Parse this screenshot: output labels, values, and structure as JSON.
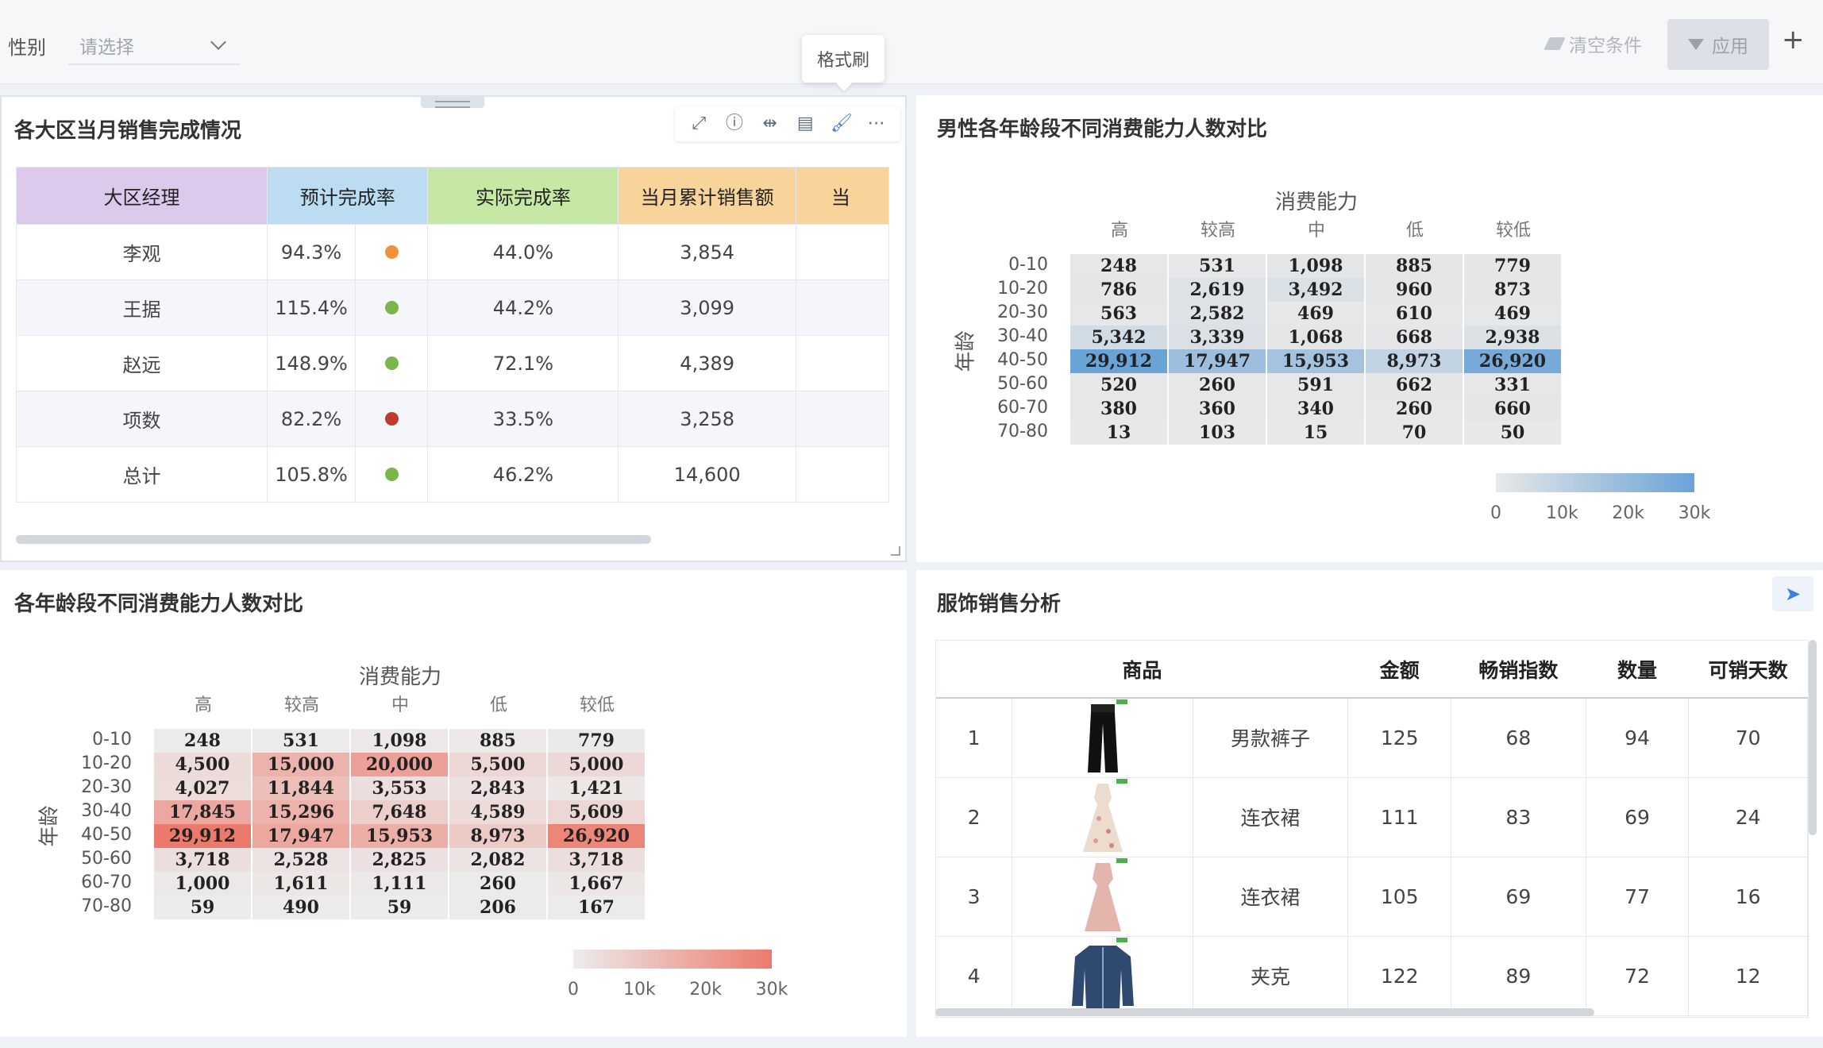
{
  "filter": {
    "label": "性别",
    "placeholder": "请选择",
    "clear_label": "清空条件",
    "apply_label": "应用",
    "add_symbol": "+"
  },
  "tooltip": "格式刷",
  "panel1": {
    "title": "各大区当月销售完成情况",
    "columns": [
      "大区经理",
      "预计完成率",
      "实际完成率",
      "当月累计销售额",
      "当"
    ],
    "header_colors": [
      "#dcc9ec",
      "#bcdcf2",
      "#c7e7a4",
      "#f8d49a",
      "#f8d49a"
    ],
    "rows": [
      {
        "name": "李观",
        "expected": "94.3%",
        "status_color": "#f0913a",
        "actual": "44.0%",
        "sales": "3,854"
      },
      {
        "name": "王据",
        "expected": "115.4%",
        "status_color": "#7ab648",
        "actual": "44.2%",
        "sales": "3,099"
      },
      {
        "name": "赵远",
        "expected": "148.9%",
        "status_color": "#7ab648",
        "actual": "72.1%",
        "sales": "4,389"
      },
      {
        "name": "项数",
        "expected": "82.2%",
        "status_color": "#c0392b",
        "actual": "33.5%",
        "sales": "3,258"
      },
      {
        "name": "总计",
        "expected": "105.8%",
        "status_color": "#7ab648",
        "actual": "46.2%",
        "sales": "14,600"
      }
    ]
  },
  "panel2": {
    "title": "男性各年龄段不同消费能力人数对比"
  },
  "panel3": {
    "title": "各年龄段不同消费能力人数对比"
  },
  "panel4": {
    "title": "服饰销售分析",
    "columns": [
      "商品",
      "金额",
      "畅销指数",
      "数量",
      "可销天数"
    ],
    "rows": [
      {
        "rank": "1",
        "name": "男款裤子",
        "amount": "125",
        "index": "68",
        "qty": "94",
        "days": "70",
        "img": "pants"
      },
      {
        "rank": "2",
        "name": "连衣裙",
        "amount": "111",
        "index": "83",
        "qty": "69",
        "days": "24",
        "img": "dress-floral"
      },
      {
        "rank": "3",
        "name": "连衣裙",
        "amount": "105",
        "index": "69",
        "qty": "77",
        "days": "16",
        "img": "dress-pink"
      },
      {
        "rank": "4",
        "name": "夹克",
        "amount": "122",
        "index": "89",
        "qty": "72",
        "days": "12",
        "img": "denim-jacket"
      }
    ]
  },
  "chart_data": [
    {
      "type": "heatmap",
      "title": "消费能力",
      "ylabel": "年龄",
      "columns": [
        "高",
        "较高",
        "中",
        "低",
        "较低"
      ],
      "rows": [
        "0-10",
        "10-20",
        "20-30",
        "30-40",
        "40-50",
        "50-60",
        "60-70",
        "70-80"
      ],
      "values": [
        [
          248,
          531,
          1098,
          885,
          779
        ],
        [
          786,
          2619,
          3492,
          960,
          873
        ],
        [
          563,
          2582,
          469,
          610,
          469
        ],
        [
          5342,
          3339,
          1068,
          668,
          2938
        ],
        [
          29912,
          17947,
          15953,
          8973,
          26920
        ],
        [
          520,
          260,
          591,
          662,
          331
        ],
        [
          380,
          360,
          340,
          260,
          660
        ],
        [
          13,
          103,
          15,
          70,
          50
        ]
      ],
      "labels": [
        [
          "248",
          "531",
          "1,098",
          "885",
          "779"
        ],
        [
          "786",
          "2,619",
          "3,492",
          "960",
          "873"
        ],
        [
          "563",
          "2,582",
          "469",
          "610",
          "469"
        ],
        [
          "5,342",
          "3,339",
          "1,068",
          "668",
          "2,938"
        ],
        [
          "29,912",
          "17,947",
          "15,953",
          "8,973",
          "26,920"
        ],
        [
          "520",
          "260",
          "591",
          "662",
          "331"
        ],
        [
          "380",
          "360",
          "340",
          "260",
          "660"
        ],
        [
          "13",
          "103",
          "15",
          "70",
          "50"
        ]
      ],
      "color_scale": {
        "min": 0,
        "max": 30000,
        "low_color": "#e8e8e8",
        "high_color": "#6aa3d6"
      },
      "legend_ticks": [
        "0",
        "10k",
        "20k",
        "30k"
      ]
    },
    {
      "type": "heatmap",
      "title": "消费能力",
      "ylabel": "年龄",
      "columns": [
        "高",
        "较高",
        "中",
        "低",
        "较低"
      ],
      "rows": [
        "0-10",
        "10-20",
        "20-30",
        "30-40",
        "40-50",
        "50-60",
        "60-70",
        "70-80"
      ],
      "values": [
        [
          248,
          531,
          1098,
          885,
          779
        ],
        [
          4500,
          15000,
          20000,
          5500,
          5000
        ],
        [
          4027,
          11844,
          3553,
          2843,
          1421
        ],
        [
          17845,
          15296,
          7648,
          4589,
          5609
        ],
        [
          29912,
          17947,
          15953,
          8973,
          26920
        ],
        [
          3718,
          2528,
          2825,
          2082,
          3718
        ],
        [
          1000,
          1611,
          1111,
          260,
          1667
        ],
        [
          59,
          490,
          59,
          206,
          167
        ]
      ],
      "labels": [
        [
          "248",
          "531",
          "1,098",
          "885",
          "779"
        ],
        [
          "4,500",
          "15,000",
          "20,000",
          "5,500",
          "5,000"
        ],
        [
          "4,027",
          "11,844",
          "3,553",
          "2,843",
          "1,421"
        ],
        [
          "17,845",
          "15,296",
          "7,648",
          "4,589",
          "5,609"
        ],
        [
          "29,912",
          "17,947",
          "15,953",
          "8,973",
          "26,920"
        ],
        [
          "3,718",
          "2,528",
          "2,825",
          "2,082",
          "3,718"
        ],
        [
          "1,000",
          "1,611",
          "1,111",
          "260",
          "1,667"
        ],
        [
          "59",
          "490",
          "59",
          "206",
          "167"
        ]
      ],
      "color_scale": {
        "min": 0,
        "max": 30000,
        "low_color": "#ececec",
        "high_color": "#ec7a6c"
      },
      "legend_ticks": [
        "0",
        "10k",
        "20k",
        "30k"
      ]
    }
  ]
}
